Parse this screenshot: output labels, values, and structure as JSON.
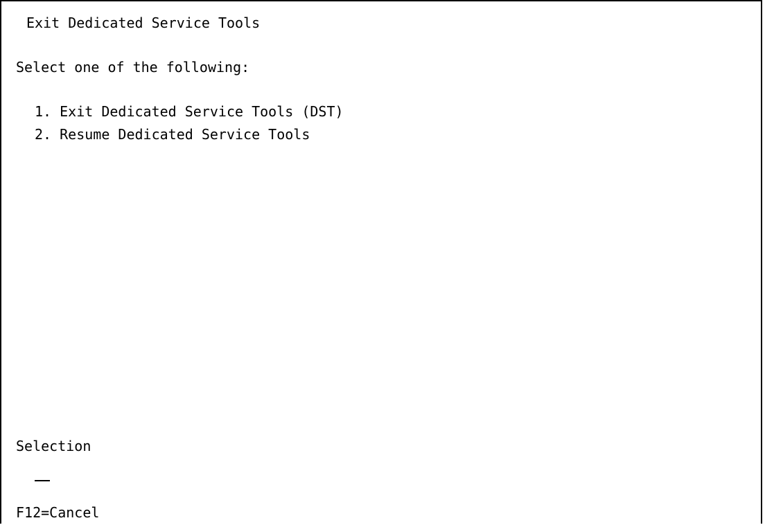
{
  "screen": {
    "title": "Exit Dedicated Service Tools",
    "prompt": "Select one of the following:",
    "options": [
      {
        "number": "1.",
        "label": "Exit Dedicated Service Tools (DST)"
      },
      {
        "number": "2.",
        "label": "Resume Dedicated Service Tools"
      }
    ],
    "selection_label": "Selection",
    "selection_value": "",
    "function_keys": "F12=Cancel"
  }
}
